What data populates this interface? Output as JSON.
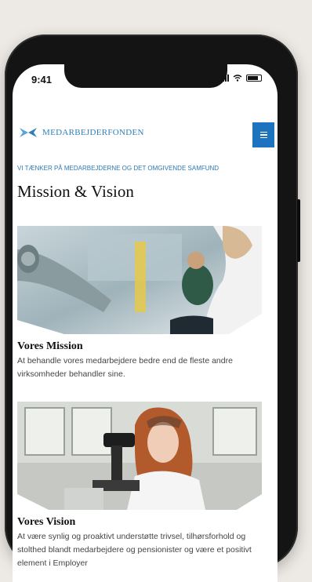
{
  "status_bar": {
    "time": "9:41"
  },
  "header": {
    "logo_text": "MEDARBEJDERFONDEN",
    "menu_icon": "hamburger-menu-icon"
  },
  "hero": {
    "eyebrow": "VI TÆNKER PÅ MEDARBEJDERNE OG DET OMGIVENDE SAMFUND",
    "title": "Mission & Vision"
  },
  "sections": [
    {
      "title": "Vores Mission",
      "text": "At behandle vores medarbejdere bedre end de fleste andre virksomheder behandler sine."
    },
    {
      "title": "Vores Vision",
      "text": "At være synlig og proaktivt understøtte trivsel, tilhørsforhold og stolthed blandt medarbejdere og pensionister og være et positivt element i Employer"
    }
  ],
  "colors": {
    "accent": "#1e73be",
    "brand_text": "#2f7fb8"
  }
}
